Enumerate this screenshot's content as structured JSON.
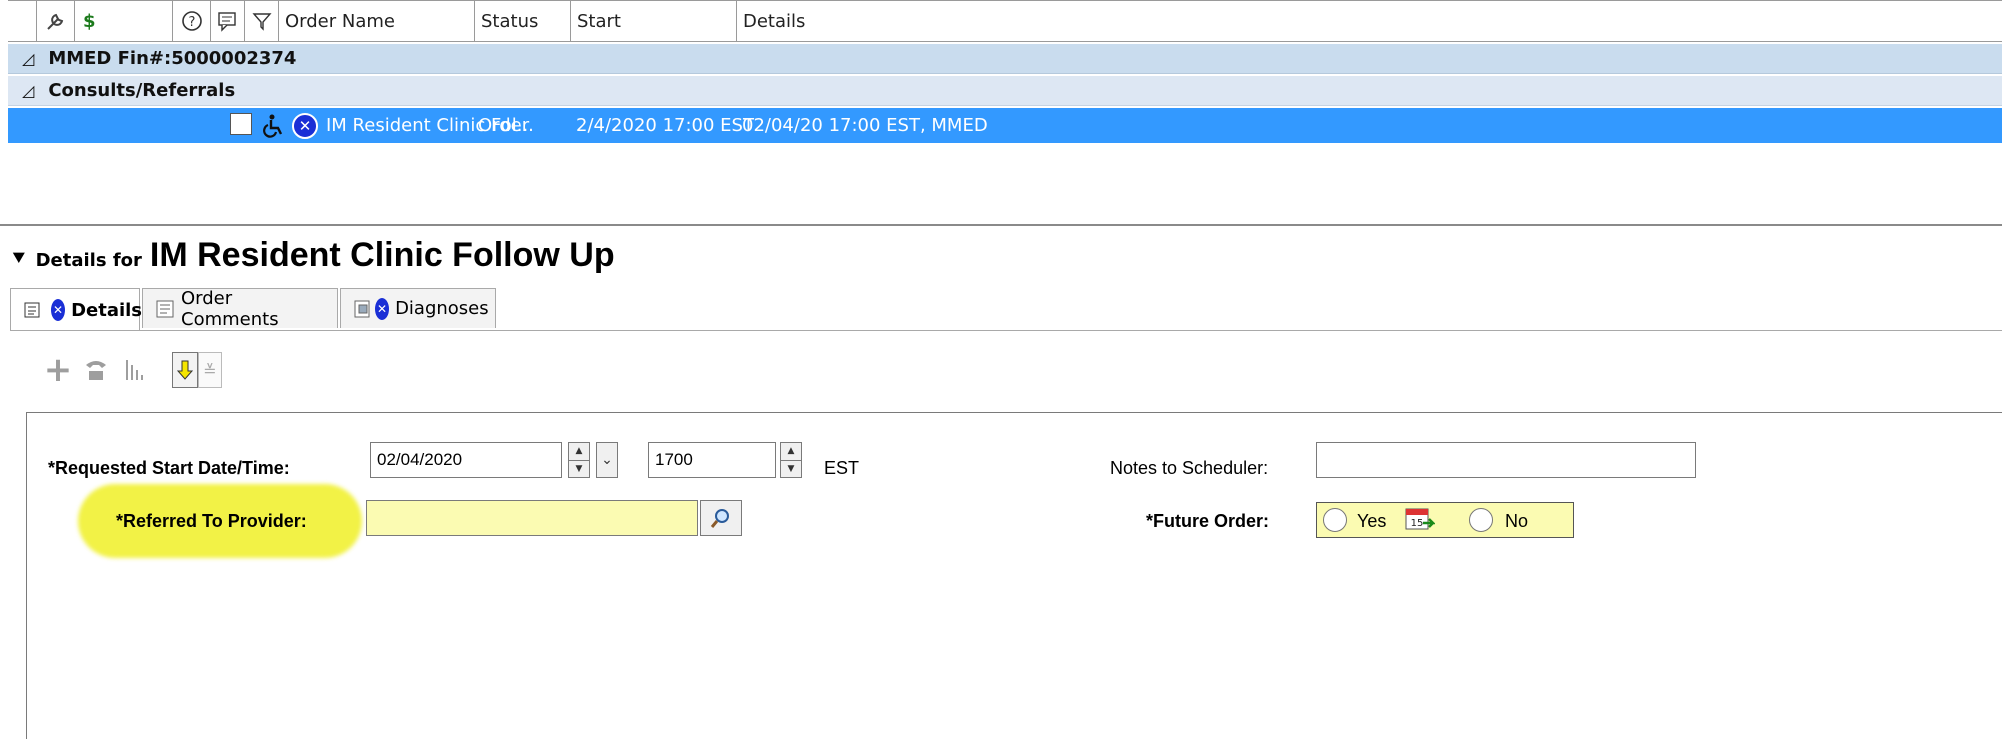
{
  "grid": {
    "headers": [
      "Order Name",
      "Status",
      "Start",
      "Details"
    ],
    "header_icons": [
      "wrench-icon",
      "dollar-icon",
      "help-circle-icon",
      "comment-icon",
      "filter-icon"
    ],
    "header_dollar": "$",
    "groups": [
      {
        "label": "MMED  Fin#:5000002374"
      },
      {
        "label": "Consults/Referrals"
      }
    ],
    "row": {
      "order_name": "IM Resident Clinic Fol...",
      "status": "Order",
      "start": "2/4/2020 17:00 EST",
      "details": "02/04/20 17:00 EST, MMED"
    }
  },
  "details": {
    "prefix": "Details for",
    "title": "IM Resident Clinic Follow Up",
    "tabs": [
      "Details",
      "Order Comments",
      "Diagnoses"
    ]
  },
  "form": {
    "start_label": "*Requested Start Date/Time:",
    "start_date": "02/04/2020",
    "start_time": "1700",
    "timezone": "EST",
    "notes_label": "Notes to Scheduler:",
    "notes_value": "",
    "provider_label": "*Referred To Provider:",
    "provider_value": "",
    "future_label": "*Future Order:",
    "yes_label": "Yes",
    "no_label": "No"
  },
  "colors": {
    "selection": "#3399ff",
    "highlight": "#f2f246",
    "required_field": "#fbfbb2",
    "group1": "#c9dcee",
    "group2": "#dde7f3"
  }
}
